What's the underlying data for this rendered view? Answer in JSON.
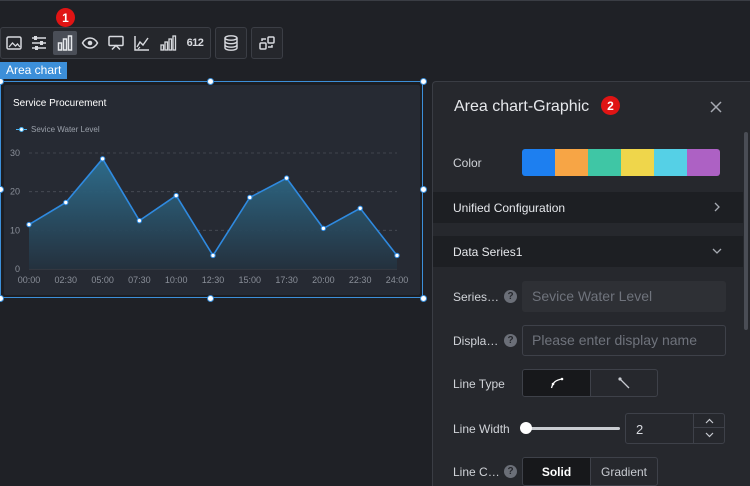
{
  "toolbar": {
    "groups": [
      {
        "icons": [
          "image-icon",
          "sliders-icon",
          "bar-chart-icon",
          "eye-icon",
          "screen-icon",
          "trend-icon",
          "signal-icon",
          "number-icon"
        ]
      },
      {
        "icons": [
          "database-icon"
        ]
      },
      {
        "icons": [
          "refresh-link-icon"
        ]
      }
    ],
    "number_icon_text": "612",
    "active_index": 2
  },
  "badges": {
    "first": "1",
    "second": "2"
  },
  "widget": {
    "tag": "Area chart"
  },
  "chart_data": {
    "type": "area",
    "title": "Service Procurement",
    "series": [
      {
        "name": "Sevice Water Level",
        "values": [
          11.5,
          17.2,
          28.5,
          12.5,
          19,
          3.5,
          18.5,
          23.5,
          10.5,
          15.7,
          3.5
        ]
      }
    ],
    "x": [
      "00:00",
      "02:30",
      "05:00",
      "07:30",
      "10:00",
      "12:30",
      "15:00",
      "17:30",
      "20:00",
      "22:30",
      "24:00"
    ],
    "y_ticks": [
      "0",
      "10",
      "20",
      "30"
    ],
    "ylim": [
      0,
      30
    ],
    "grid": true,
    "legend": "top-left",
    "colors": {
      "line": "#2f8ae0",
      "area_top": "#2e6f8f",
      "area_bottom": "#24313e"
    }
  },
  "panel": {
    "title": "Area chart-Graphic",
    "color_label": "Color",
    "palette": [
      "#1d7ff0",
      "#f7a545",
      "#3fc6a5",
      "#efd64b",
      "#55d0e6",
      "#ad61c4"
    ],
    "unified_config": "Unified Configuration",
    "data_series": "Data Series1",
    "series_name_label": "Series…",
    "series_name_value": "Sevice Water Level",
    "display_label": "Displa…",
    "display_placeholder": "Please enter display name",
    "line_type_label": "Line Type",
    "line_width_label": "Line Width",
    "line_width_value": "2",
    "line_width_fraction": 0,
    "line_color_label": "Line C…",
    "line_color_options": [
      "Solid",
      "Gradient"
    ],
    "help": "?"
  }
}
